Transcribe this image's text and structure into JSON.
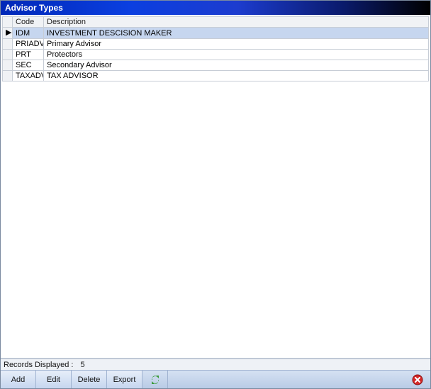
{
  "title": "Advisor Types",
  "columns": {
    "code": "Code",
    "description": "Description"
  },
  "rows": [
    {
      "code": "IDM",
      "description": "INVESTMENT DESCISION MAKER",
      "selected": true
    },
    {
      "code": "PRIADV",
      "description": "Primary Advisor",
      "selected": false
    },
    {
      "code": "PRT",
      "description": "Protectors",
      "selected": false
    },
    {
      "code": "SEC",
      "description": "Secondary Advisor",
      "selected": false
    },
    {
      "code": "TAXADV",
      "description": "TAX ADVISOR",
      "selected": false
    }
  ],
  "status": {
    "label": "Records Displayed :",
    "count": "5"
  },
  "toolbar": {
    "add": "Add",
    "edit": "Edit",
    "delete": "Delete",
    "export": "Export"
  }
}
